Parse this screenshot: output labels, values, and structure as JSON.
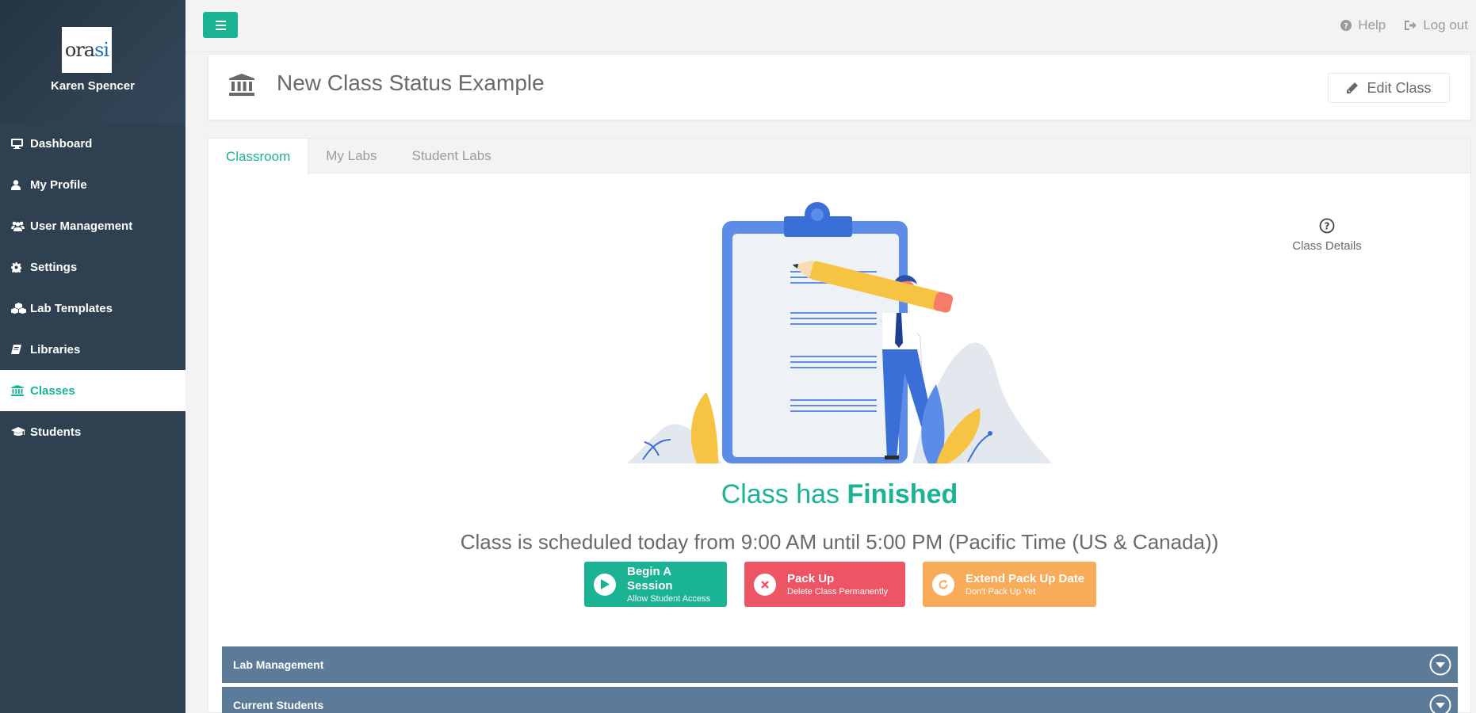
{
  "sidebar": {
    "logo_text": "orasi",
    "user_name": "Karen Spencer",
    "items": [
      {
        "label": "Dashboard",
        "icon": "desktop-icon"
      },
      {
        "label": "My Profile",
        "icon": "user-icon"
      },
      {
        "label": "User Management",
        "icon": "users-icon"
      },
      {
        "label": "Settings",
        "icon": "gear-icon"
      },
      {
        "label": "Lab Templates",
        "icon": "cubes-icon"
      },
      {
        "label": "Libraries",
        "icon": "book-icon"
      },
      {
        "label": "Classes",
        "icon": "institution-icon",
        "active": true
      },
      {
        "label": "Students",
        "icon": "graduation-cap-icon"
      }
    ]
  },
  "topbar": {
    "help_label": "Help",
    "logout_label": "Log out"
  },
  "header": {
    "title": "New Class Status Example",
    "edit_label": "Edit Class"
  },
  "tabs": [
    {
      "label": "Classroom",
      "active": true
    },
    {
      "label": "My Labs"
    },
    {
      "label": "Student Labs"
    }
  ],
  "class_details_label": "Class Details",
  "status": {
    "prefix": "Class has",
    "state": "Finished",
    "schedule": "Class is scheduled today from 9:00 AM until 5:00 PM (Pacific Time (US & Canada))"
  },
  "actions": [
    {
      "title": "Begin A Session",
      "subtitle": "Allow Student Access",
      "color": "#1ab394"
    },
    {
      "title": "Pack Up",
      "subtitle": "Delete Class Permanently",
      "color": "#ed5565"
    },
    {
      "title": "Extend Pack Up Date",
      "subtitle": "Don't Pack Up Yet",
      "color": "#f8ac59"
    }
  ],
  "sections": [
    {
      "label": "Lab Management"
    },
    {
      "label": "Current Students"
    }
  ],
  "colors": {
    "sidebar": "#2f4050",
    "accent": "#1ab394",
    "accordion": "#5b7b98"
  }
}
